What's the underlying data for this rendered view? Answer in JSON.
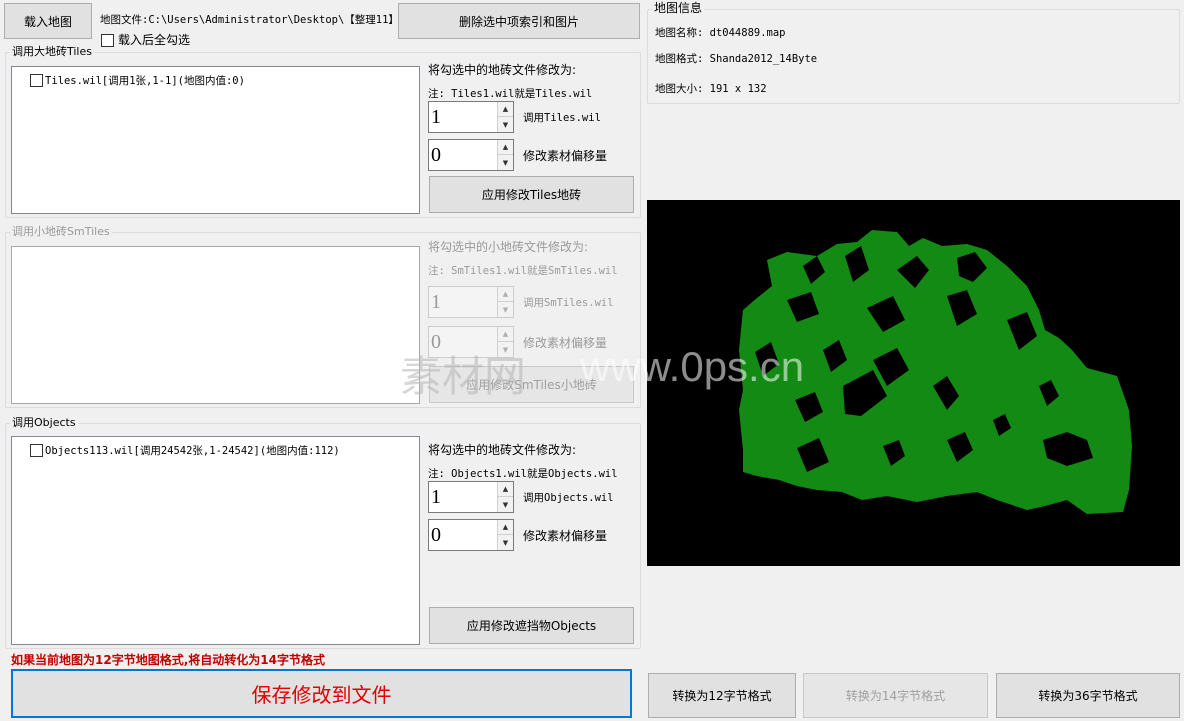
{
  "top": {
    "load_map_label": "载入地图",
    "map_file_label": "地图文件:C:\\Users\\Administrator\\Desktop\\【整理11】",
    "delete_label": "删除选中项索引和图片",
    "select_all_label": "载入后全勾选"
  },
  "tiles": {
    "title": "调用大地砖Tiles",
    "items": [
      "Tiles.wil[调用1张,1-1](地图内值:0)"
    ],
    "modify_label": "将勾选中的地砖文件修改为:",
    "note": "注: Tiles1.wil就是Tiles.wil",
    "spin1_value": "1",
    "spin1_label": "调用Tiles.wil",
    "spin2_value": "0",
    "spin2_label": "修改素材偏移量",
    "apply_label": "应用修改Tiles地砖"
  },
  "smtiles": {
    "title": "调用小地砖SmTiles",
    "modify_label": "将勾选中的小地砖文件修改为:",
    "note": "注: SmTiles1.wil就是SmTiles.wil",
    "spin1_value": "1",
    "spin1_label": "调用SmTiles.wil",
    "spin2_value": "0",
    "spin2_label": "修改素材偏移量",
    "apply_label": "应用修改SmTiles小地砖"
  },
  "objects": {
    "title": "调用Objects",
    "items": [
      "Objects113.wil[调用24542张,1-24542](地图内值:112)"
    ],
    "modify_label": "将勾选中的地砖文件修改为:",
    "note": "注: Objects1.wil就是Objects.wil",
    "spin1_value": "1",
    "spin1_label": "调用Objects.wil",
    "spin2_value": "0",
    "spin2_label": "修改素材偏移量",
    "apply_label": "应用修改遮挡物Objects"
  },
  "info": {
    "title": "地图信息",
    "name": "地图名称: dt044889.map",
    "format": "地图格式: Shanda2012_14Byte",
    "size": "地图大小: 191 x 132"
  },
  "bottom": {
    "warning": "如果当前地图为12字节地图格式,将自动转化为14字节格式",
    "save_label": "保存修改到文件",
    "convert12_label": "转换为12字节格式",
    "convert14_label": "转换为14字节格式",
    "convert36_label": "转换为36字节格式"
  },
  "watermark": {
    "cn": "素材网",
    "en": "www.0ps.cn"
  },
  "colors": {
    "map_bg": "#000000",
    "map_fill": "#138a13",
    "accent": "#0078d7",
    "warning": "#c00000"
  }
}
